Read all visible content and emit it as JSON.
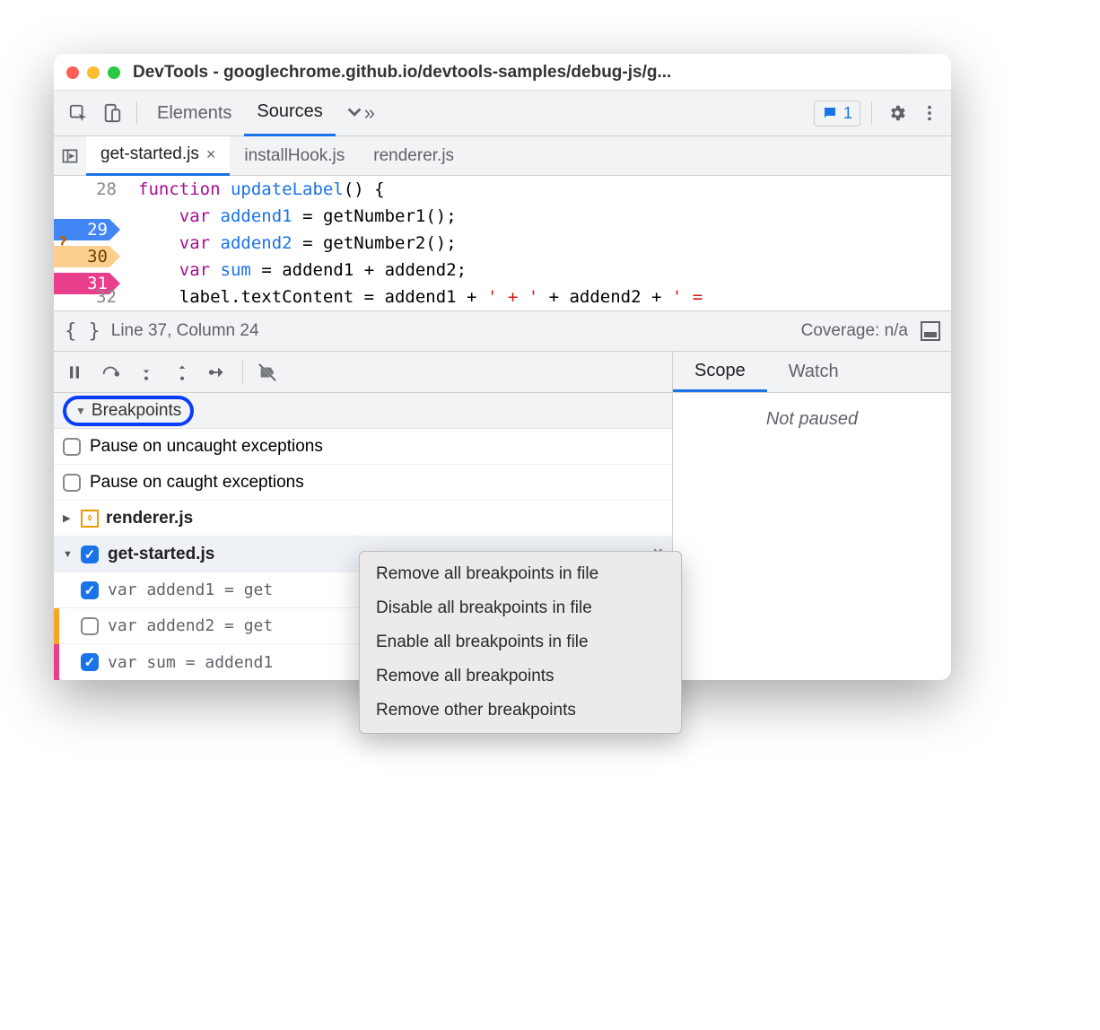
{
  "window": {
    "title": "DevTools - googlechrome.github.io/devtools-samples/debug-js/g..."
  },
  "toolbar": {
    "tabs": [
      "Elements",
      "Sources"
    ],
    "active_tab": "Sources",
    "feedback_count": "1"
  },
  "file_tabs": {
    "items": [
      {
        "label": "get-started.js",
        "active": true,
        "closable": true
      },
      {
        "label": "installHook.js",
        "active": false,
        "closable": false
      },
      {
        "label": "renderer.js",
        "active": false,
        "closable": false
      }
    ]
  },
  "code": {
    "lines": [
      {
        "n": "28",
        "bp": null,
        "html": "function updateLabel() {"
      },
      {
        "n": "29",
        "bp": "blue",
        "html": "    var addend1 = getNumber1();"
      },
      {
        "n": "30",
        "bp": "orange",
        "mark": "?",
        "html": "    var addend2 = getNumber2();"
      },
      {
        "n": "31",
        "bp": "pink",
        "mark": "··",
        "html": "    var sum = addend1 + addend2;"
      },
      {
        "n": "32",
        "bp": null,
        "html": "    label.textContent = addend1 + ' + ' + addend2 + ' ="
      }
    ]
  },
  "statusbar": {
    "position": "Line 37, Column 24",
    "coverage": "Coverage: n/a"
  },
  "right_panel": {
    "tabs": [
      "Scope",
      "Watch"
    ],
    "active": "Scope",
    "not_paused": "Not paused"
  },
  "breakpoints_section": {
    "title": "Breakpoints",
    "pause_uncaught": "Pause on uncaught exceptions",
    "pause_caught": "Pause on caught exceptions",
    "files": [
      {
        "name": "renderer.js",
        "expanded": false,
        "checked": false,
        "icon": true
      },
      {
        "name": "get-started.js",
        "expanded": true,
        "checked": true,
        "icon": false
      }
    ],
    "entries": [
      {
        "checked": true,
        "marker": "",
        "text": "var addend1 = get"
      },
      {
        "checked": false,
        "marker": "orange",
        "text": "var addend2 = get"
      },
      {
        "checked": true,
        "marker": "pink",
        "text": "var sum = addend1"
      }
    ]
  },
  "context_menu": {
    "items": [
      "Remove all breakpoints in file",
      "Disable all breakpoints in file",
      "Enable all breakpoints in file",
      "Remove all breakpoints",
      "Remove other breakpoints"
    ]
  }
}
